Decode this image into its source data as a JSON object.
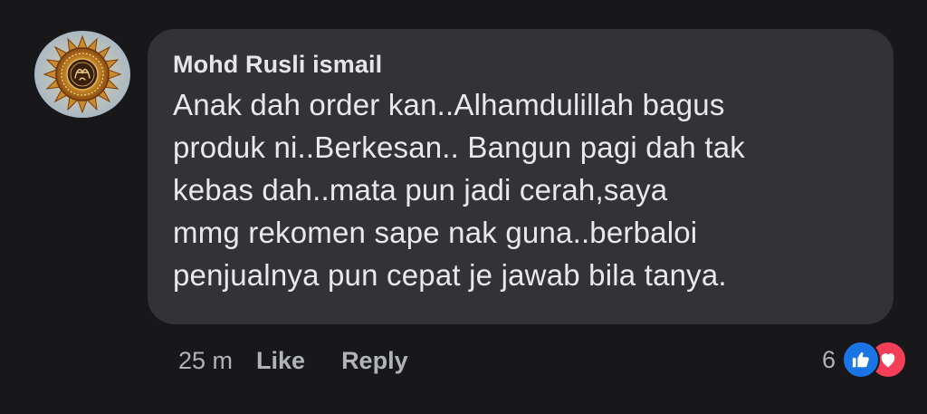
{
  "comment": {
    "author": "Mohd Rusli ismail",
    "avatar_icon": "islamic-calligraphy-avatar",
    "lines": [
      "Anak dah order kan..Alhamdulillah bagus",
      "produk ni..Berkesan.. Bangun pagi dah tak",
      "kebas dah..mata pun jadi cerah,saya",
      "mmg rekomen sape nak guna..berbaloi",
      "penjualnya pun cepat je jawab bila tanya."
    ]
  },
  "actions": {
    "timestamp": "25 m",
    "like_label": "Like",
    "reply_label": "Reply"
  },
  "reactions": {
    "count": "6",
    "icons": [
      "thumbs-up-icon",
      "heart-icon"
    ],
    "like_color": "#1b74e4",
    "love_color": "#f33e58"
  },
  "colors": {
    "background": "#18181a",
    "bubble": "#333336",
    "text": "#e9e9eb",
    "meta_text": "#b0b3b8"
  }
}
